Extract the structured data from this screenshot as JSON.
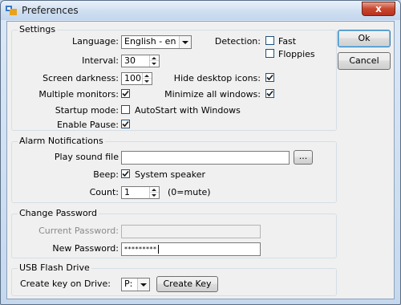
{
  "window": {
    "title": "Preferences",
    "close_glyph": "x"
  },
  "settings": {
    "group_title": "Settings",
    "language_label": "Language:",
    "language_value": "English - en",
    "detection_label": "Detection:",
    "fast_label": "Fast",
    "fast_checked": false,
    "floppies_label": "Floppies",
    "floppies_checked": false,
    "interval_label": "Interval:",
    "interval_value": "30",
    "screen_darkness_label": "Screen darkness:",
    "screen_darkness_value": "100",
    "hide_desktop_icons_label": "Hide desktop icons:",
    "hide_desktop_icons_checked": true,
    "multiple_monitors_label": "Multiple monitors:",
    "multiple_monitors_checked": true,
    "minimize_all_label": "Minimize all windows:",
    "minimize_all_checked": true,
    "startup_mode_label": "Startup mode:",
    "autostart_label": "AutoStart with Windows",
    "autostart_checked": false,
    "enable_pause_label": "Enable Pause:",
    "enable_pause_checked": true
  },
  "alarm": {
    "group_title": "Alarm Notifications",
    "play_sound_label": "Play sound file",
    "play_sound_value": "",
    "browse_label": "...",
    "beep_label": "Beep:",
    "system_speaker_label": "System speaker",
    "system_speaker_checked": true,
    "count_label": "Count:",
    "count_value": "1",
    "count_hint": "(0=mute)"
  },
  "password": {
    "group_title": "Change Password",
    "current_label": "Current Password:",
    "current_value": "",
    "new_label": "New Password:",
    "new_value": "*********"
  },
  "usb": {
    "group_title": "USB Flash Drive",
    "create_key_on_label": "Create key on Drive:",
    "drive_value": "P:",
    "create_key_button": "Create Key"
  },
  "buttons": {
    "ok": "Ok",
    "cancel": "Cancel"
  }
}
